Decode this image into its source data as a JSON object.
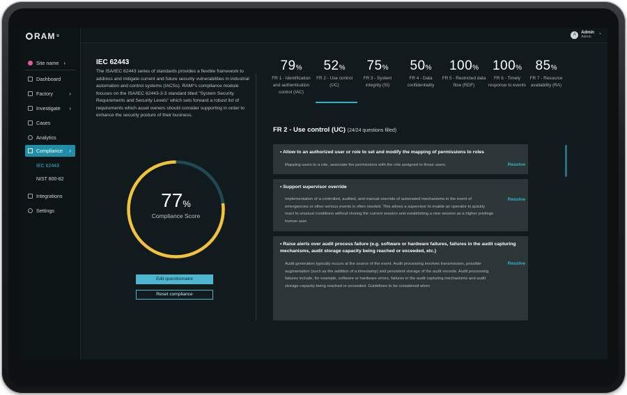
{
  "app": {
    "logo": "RAM",
    "logo_sup": "®"
  },
  "user": {
    "initial": "A",
    "name": "Admin",
    "role": "Admin"
  },
  "sidebar": {
    "site": "Site name",
    "items": [
      {
        "label": "Dashboard",
        "icon": "dashboard-icon"
      },
      {
        "label": "Factory",
        "icon": "factory-icon",
        "chevron": ">"
      },
      {
        "label": "Investigate",
        "icon": "chart-line-icon",
        "chevron": ">"
      },
      {
        "label": "Cases",
        "icon": "clipboard-icon"
      },
      {
        "label": "Analytics",
        "icon": "analytics-icon"
      },
      {
        "label": "Compliance",
        "icon": "checklist-icon",
        "chevron": ">"
      },
      {
        "label": "Integrations",
        "icon": "plug-icon"
      },
      {
        "label": "Settings",
        "icon": "gear-icon"
      }
    ],
    "compliance_sub": [
      "IEC 62443",
      "NIST 800-82"
    ]
  },
  "main": {
    "title": "IEC 62443",
    "description": "The ISA/IEC 62443 series of standards provides a flexible framework to address and mitigate current and future security vulnerabilities in industrial automation and control systems (IACSs). RAM²'s compliance module focuses on the ISA/IEC 62443-3-3 standard titled \"System Security Requirements and Security Levels\" which sets forward a robust list of requirements which asset owners should consider supporting in order to enhance the security posture of their business.",
    "score": {
      "value": "77",
      "unit": "%",
      "label": "Compliance Score",
      "fraction": 0.77
    },
    "buttons": {
      "edit": "Edit questionnaire",
      "reset": "Reset compliance"
    }
  },
  "scores": [
    {
      "value": "79",
      "label": "FR 1 - Identification and authentication control (IAC)"
    },
    {
      "value": "52",
      "label": "FR 2 - Use control (UC)"
    },
    {
      "value": "75",
      "label": "FR 3 - System integrity (SI)"
    },
    {
      "value": "50",
      "label": "FR 4 - Data confidentiality"
    },
    {
      "value": "100",
      "label": "FR 5 - Restricted data flow (RDF)"
    },
    {
      "value": "100",
      "label": "FR 6 - Timely response to events"
    },
    {
      "value": "85",
      "label": "FR 7 - Resource availability (RA)"
    }
  ],
  "section": {
    "title": "FR 2 - Use control (UC)",
    "subtitle": "(24/24 questions filled)",
    "cards": [
      {
        "heading": "• Allow to an authorized user or role to set and modify the mapping of permissions to roles",
        "body": "Mapping users to a role, associate the permissions with the role assigned to those users.",
        "action": "Resolve"
      },
      {
        "heading": "• Support supervisor override",
        "body": "Implementation of a controlled, audited, and manual override of automated mechanisms in the event of emergencies or other serious events is often needed. This allows a supervisor to enable an operator to quickly react to unusual conditions without closing the current session and establishing a new session as a higher privilege human user.",
        "action": "Resolve"
      },
      {
        "heading": "• Raise alerts over audit process failure (e.g. software or hardware failures, failures in the audit capturing mechanisms, audit storage capacity being reached or exceeded, etc.)",
        "body": "Audit generation typically occurs at the source of the event. Audit processing involves transmission, possible augmentation (such as the addition of a timestamp) and persistent storage of the audit records. Audit processing failures include, for example, software or hardware errors, failures in the audit capturing mechanisms and audit storage capacity being reached or exceeded. Guidelines to be considered when",
        "action": "Resolve"
      }
    ]
  },
  "colors": {
    "accent": "#2fb4cf",
    "gauge": "#f2c23a",
    "gauge_track": "#1f4a55",
    "site_dot": "#e05ca0"
  }
}
